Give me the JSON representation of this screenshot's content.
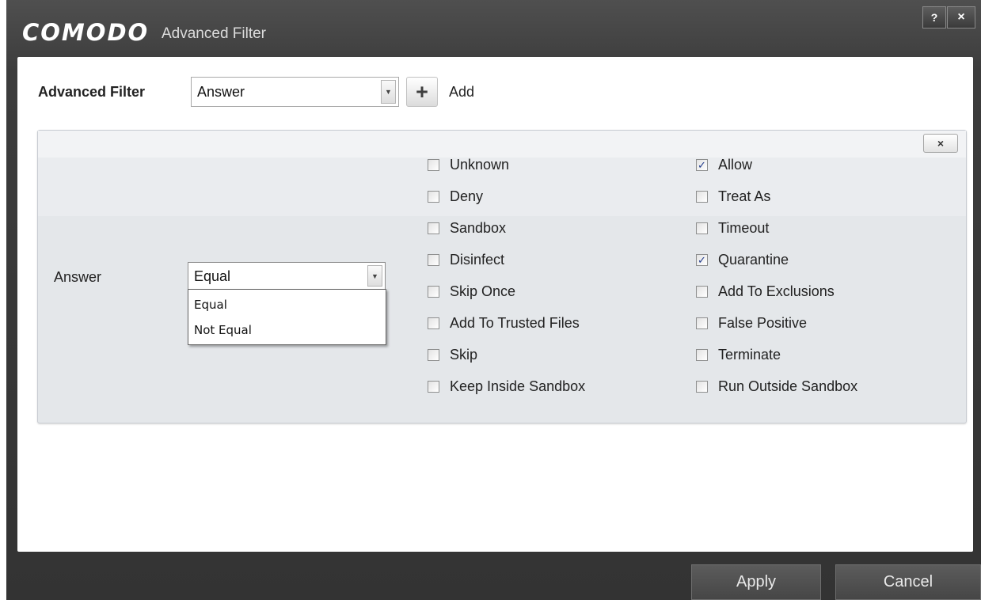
{
  "window": {
    "logo": "COMODO",
    "title": "Advanced Filter",
    "help_label": "?",
    "close_label": "×"
  },
  "filter": {
    "label": "Advanced Filter",
    "selected": "Answer",
    "add_label": "Add"
  },
  "panel": {
    "close_label": "×",
    "field_label": "Answer",
    "operator": {
      "selected": "Equal",
      "options": [
        "Equal",
        "Not Equal"
      ]
    },
    "options_left": [
      {
        "label": "Unknown",
        "checked": false
      },
      {
        "label": "Deny",
        "checked": false
      },
      {
        "label": "Sandbox",
        "checked": false
      },
      {
        "label": "Disinfect",
        "checked": false
      },
      {
        "label": "Skip Once",
        "checked": false
      },
      {
        "label": "Add To Trusted Files",
        "checked": false
      },
      {
        "label": "Skip",
        "checked": false
      },
      {
        "label": "Keep Inside Sandbox",
        "checked": false
      }
    ],
    "options_right": [
      {
        "label": "Allow",
        "checked": true
      },
      {
        "label": "Treat As",
        "checked": false
      },
      {
        "label": "Timeout",
        "checked": false
      },
      {
        "label": "Quarantine",
        "checked": true
      },
      {
        "label": "Add To Exclusions",
        "checked": false
      },
      {
        "label": "False Positive",
        "checked": false
      },
      {
        "label": "Terminate",
        "checked": false
      },
      {
        "label": "Run Outside Sandbox",
        "checked": false
      }
    ]
  },
  "footer": {
    "apply_label": "Apply",
    "cancel_label": "Cancel"
  }
}
